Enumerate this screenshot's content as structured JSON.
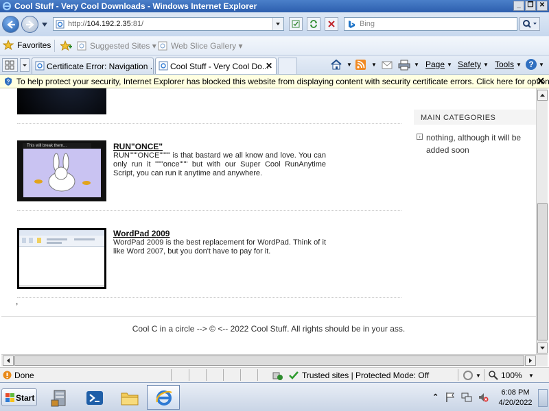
{
  "window": {
    "title": "Cool Stuff - Very Cool Downloads - Windows Internet Explorer",
    "controls": [
      "_",
      "❒",
      "✕"
    ]
  },
  "address": {
    "url_prefix": "http://",
    "url_host": "104.192.2.35",
    "url_suffix": ":81/",
    "search_placeholder": "Bing"
  },
  "favorites_bar": {
    "favorites_label": "Favorites",
    "items": [
      "Suggested Sites ▾",
      "Web Slice Gallery ▾"
    ]
  },
  "tabs": [
    {
      "label": "Certificate Error: Navigation ...",
      "active": false
    },
    {
      "label": "Cool Stuff - Very Cool Do...",
      "active": true
    }
  ],
  "command_bar": {
    "page": "Page",
    "safety": "Safety",
    "tools": "Tools"
  },
  "infobar": {
    "message": "To help protect your security, Internet Explorer has blocked this website from displaying content with security certificate errors. Click here for options..."
  },
  "posts": [
    {
      "title": "RUN\"ONCE\"",
      "body": "RUN\"\"\"ONCE\"\"\"\" is that bastard we all know and love. You can only run it \"\"\"once\"\"\" but with our Super Cool RunAnytime Script, you can run it anytime and anywhere.",
      "thumb_caption": "This will break them..."
    },
    {
      "title": "WordPad 2009",
      "body": "WordPad 2009 is the best replacement for WordPad. Think of it like Word 2007, but you don't have to pay for it."
    }
  ],
  "stray_text": ",",
  "sidebar": {
    "heading": "MAIN CATEGORIES",
    "items": [
      "nothing, although it will be added soon"
    ]
  },
  "footer": {
    "text": "Cool C in a circle --> © <-- 2022 Cool Stuff. All rights should be in your ass."
  },
  "statusbar": {
    "status": "Done",
    "zone": "Trusted sites | Protected Mode: Off",
    "zoom": "100%"
  },
  "taskbar": {
    "start_label": "Start",
    "time": "6:08 PM",
    "date": "4/20/2022"
  },
  "colors": {
    "titlebar": "#2d5fae",
    "infobar": "#ffffe1",
    "link": "#111111"
  }
}
